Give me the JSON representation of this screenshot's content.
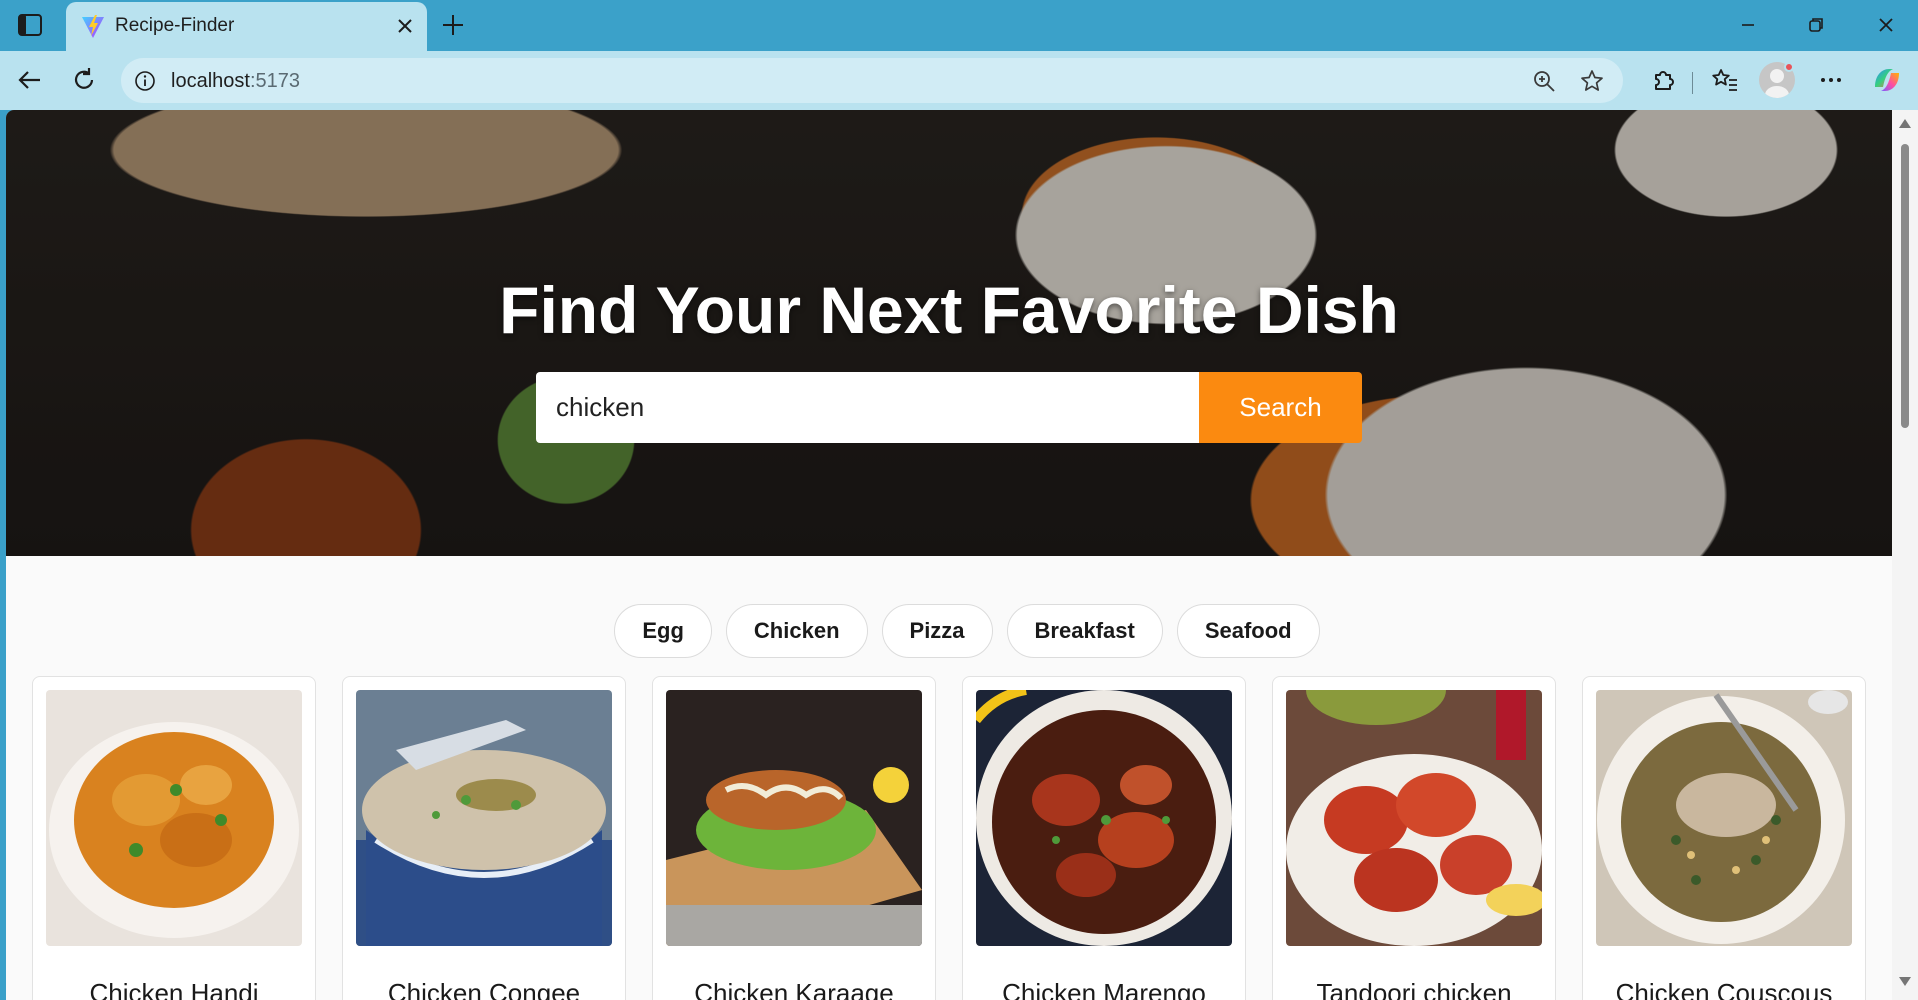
{
  "browser": {
    "tab_title": "Recipe-Finder",
    "address_host": "localhost",
    "address_port": ":5173",
    "icons": [
      "window-menu-icon",
      "vite-favicon-icon",
      "close-icon",
      "plus-icon",
      "minimize-icon",
      "restore-icon",
      "back-icon",
      "refresh-icon",
      "info-icon",
      "zoom-icon",
      "star-icon",
      "extensions-icon",
      "favorites-icon",
      "profile-avatar",
      "more-icon",
      "copilot-icon"
    ]
  },
  "hero": {
    "title": "Find Your Next Favorite Dish",
    "search_value": "chicken",
    "search_button": "Search"
  },
  "categories": [
    "Egg",
    "Chicken",
    "Pizza",
    "Breakfast",
    "Seafood"
  ],
  "recipes": [
    {
      "title": "Chicken Handi"
    },
    {
      "title": "Chicken Congee"
    },
    {
      "title": "Chicken Karaage"
    },
    {
      "title": "Chicken Marengo"
    },
    {
      "title": "Tandoori chicken"
    },
    {
      "title": "Chicken Couscous"
    }
  ],
  "colors": {
    "titlebar": "#3ba1c9",
    "toolbar": "#b9e2ef",
    "search_button": "#fb8a10",
    "page_bg": "#fafafa"
  }
}
